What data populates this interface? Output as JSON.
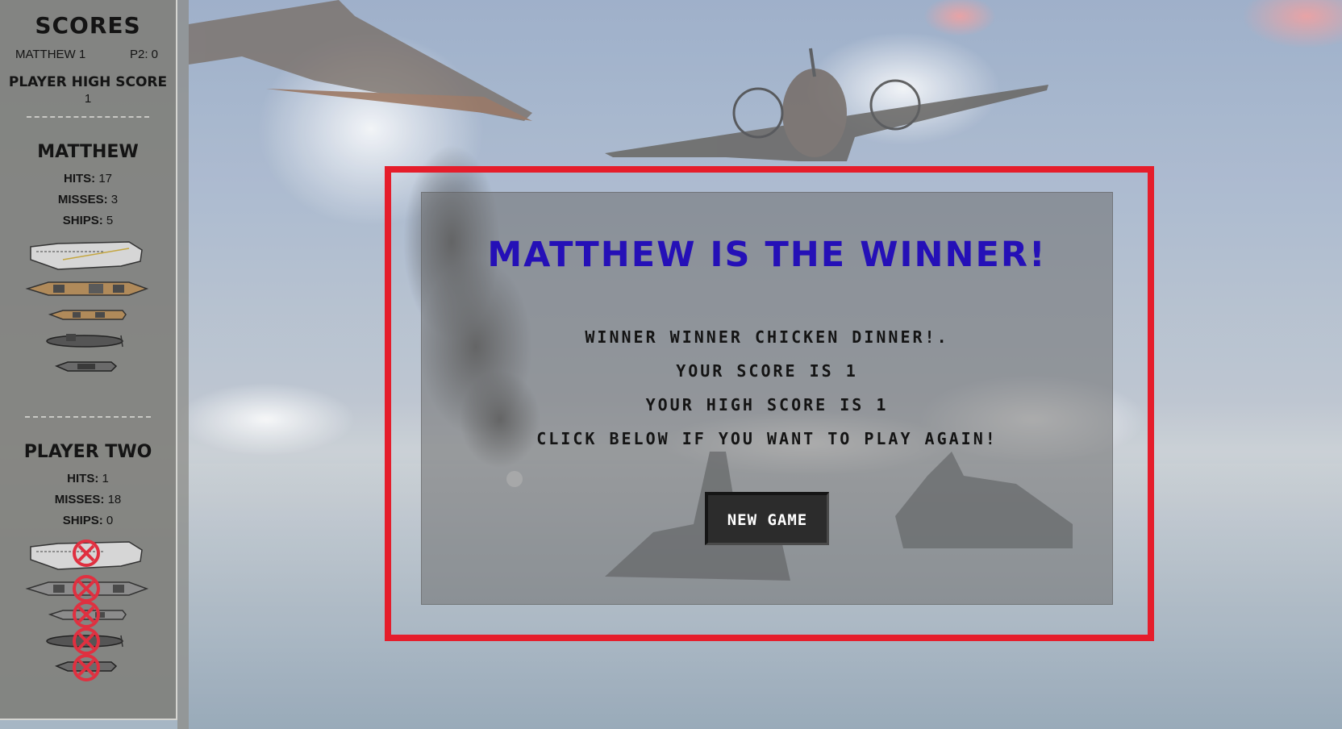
{
  "sidebar": {
    "title": "SCORES",
    "p1_score_label": "MATTHEW 1",
    "p2_score_label": "P2: 0",
    "high_score_title": "PLAYER HIGH SCORE",
    "high_score_value": "1",
    "player1": {
      "name": "MATTHEW",
      "hits_label": "HITS:",
      "hits": "17",
      "misses_label": "MISSES:",
      "misses": "3",
      "ships_label": "SHIPS:",
      "ships": "5"
    },
    "player2": {
      "name": "PLAYER TWO",
      "hits_label": "HITS:",
      "hits": "1",
      "misses_label": "MISSES:",
      "misses": "18",
      "ships_label": "SHIPS:",
      "ships": "0"
    }
  },
  "modal": {
    "title": "MATTHEW IS THE WINNER!",
    "line1": "WINNER WINNER CHICKEN DINNER!.",
    "line2": "YOUR SCORE IS 1",
    "line3": "YOUR HIGH SCORE IS 1",
    "line4": "CLICK BELOW IF YOU WANT TO PLAY AGAIN!",
    "button_label": "NEW GAME"
  },
  "colors": {
    "frame": "#e51d2b",
    "title": "#2510b7",
    "hit_marker": "#e03040"
  }
}
